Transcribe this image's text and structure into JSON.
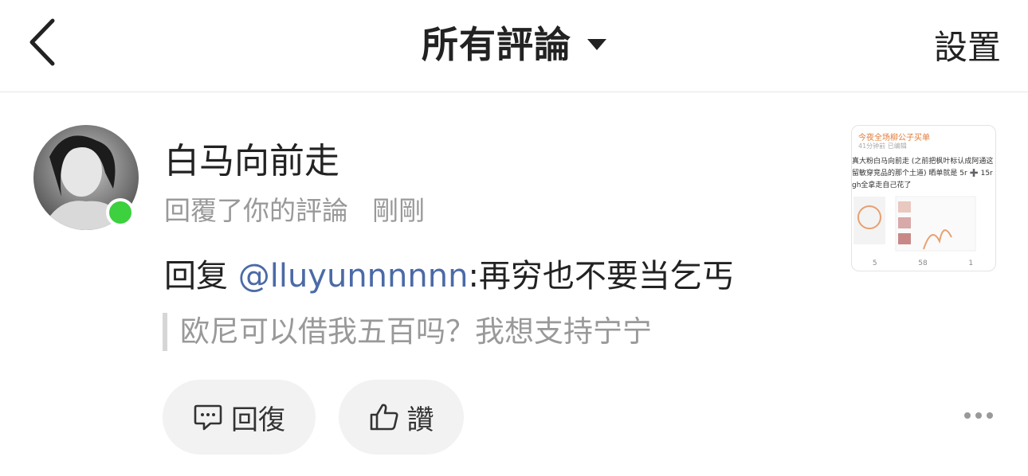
{
  "header": {
    "title": "所有評論",
    "settings_label": "設置",
    "icons": {
      "back": "back-chevron-icon",
      "dropdown": "caret-down-icon"
    }
  },
  "comment": {
    "username": "白马向前走",
    "action": "回覆了你的評論",
    "time": "剛剛",
    "reply_prefix": "回复 ",
    "mention": "@lluyunnnnnn",
    "reply_text": ":再穷也不要当乞丐",
    "quoted_text": "欧尼可以借我五百吗？我想支持宁宁",
    "online_color": "#3dd03f",
    "mention_color": "#4b6aa7"
  },
  "actions": {
    "reply_label": "回復",
    "like_label": "讚",
    "icons": {
      "reply": "comment-bubble-icon",
      "like": "thumbs-up-icon",
      "more": "more-dots-icon"
    }
  },
  "thumbnail": {
    "header": "今夜全场柳公子买单",
    "subheader": "41分钟前  已编辑",
    "body": "真大粉白马向前走 (之前把枫叶标认成阿通这\n留敏穿竞品的那个土道) 晒单就是 5r ➕ 15r ➕\ngh全拿走自己花了",
    "repost_count": "5",
    "comment_count": "58",
    "like_count": "1"
  }
}
